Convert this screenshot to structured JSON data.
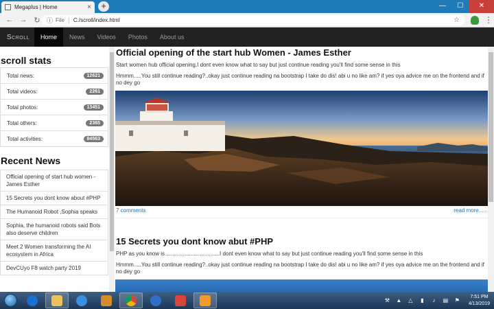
{
  "browser": {
    "tab_title": "Megaplus | Home",
    "tab_close": "×",
    "new_tab": "+",
    "url_scheme": "File",
    "url": "C:/scroll/index.html"
  },
  "site": {
    "brand": "Scroll",
    "nav": [
      {
        "label": "Home",
        "active": true
      },
      {
        "label": "News"
      },
      {
        "label": "Videos"
      },
      {
        "label": "Photos"
      },
      {
        "label": "About us"
      }
    ]
  },
  "sidebar": {
    "stats_heading": "scroll stats",
    "stats": [
      {
        "label": "Total news:",
        "value": "12621"
      },
      {
        "label": "Total videos:",
        "value": "2261"
      },
      {
        "label": "Total photos:",
        "value": "13451"
      },
      {
        "label": "Total others:",
        "value": "2365"
      },
      {
        "label": "Total activities:",
        "value": "84563"
      }
    ],
    "recent_heading": "Recent News",
    "recent": [
      "Official opening of start hub women - James Esther",
      "15 Secrets you dont know about #PHP",
      "The Humanoid Robot ,Sophia speaks",
      "Sophia, the humanoid robots said Bots also deserve children",
      "Meet 2 Women transforming the AI ecosystem in Africa",
      "DevCUyo F8 watch party 2019"
    ]
  },
  "posts": [
    {
      "title": "Official opening of the start hub Women - James Esther",
      "lead": "Start women hub official opening,I dont even know what to say but just continue reading you'll find some sense in this",
      "body": "Hmmm.....You still continue reading?..okay just continue reading na bootstrap I take do dis! abi u no like am? if yes oya advice me on the frontend and if no dey go",
      "comments": "7 comments",
      "read_more": "read more......"
    },
    {
      "title": "15 Secrets you dont know abut #PHP",
      "lead": "PHP as you know is ...................................I dont even know what to say but just continue reading you'll find some sense in this",
      "body": "Hmmm.....You still continue reading?..okay just continue reading na bootstrap I take do dis! abi u no like am? if yes oya advice me on the frontend and if no dey go"
    }
  ],
  "taskbar": {
    "time": "7:51 PM",
    "date": "4/13/2019"
  },
  "colors": {
    "navbar": "#222222",
    "link": "#2a6fb0",
    "badge": "#777777",
    "titlebar": "#1f7ab8"
  }
}
